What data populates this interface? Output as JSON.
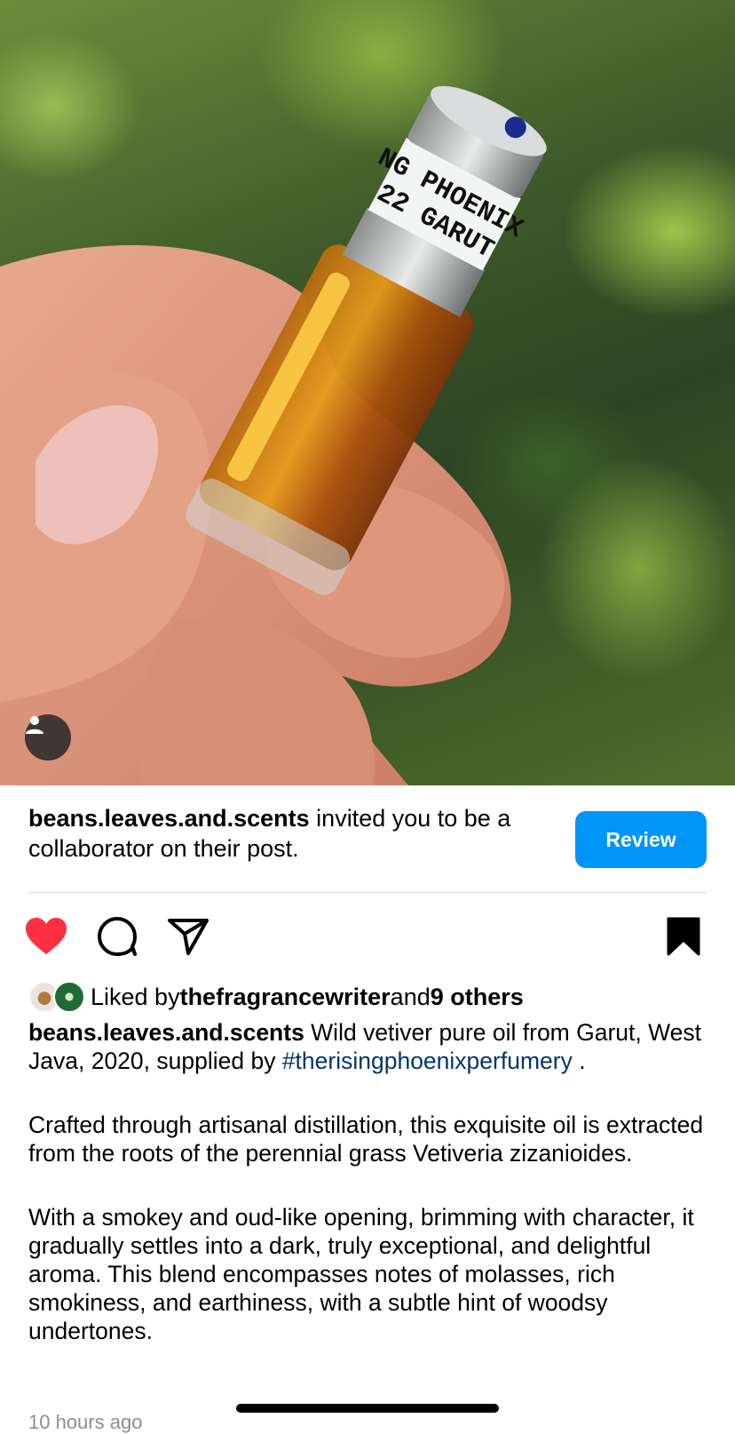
{
  "post": {
    "photo_label_line1": "NG PHOENIX",
    "photo_label_line2": "22 GARUT",
    "tag_icon": "person-icon"
  },
  "collab": {
    "username": "beans.leaves.and.scents",
    "message": " invited you to be a collaborator on their post.",
    "review_label": "Review",
    "review_color": "#0095f6"
  },
  "actions": {
    "like_icon": "heart-filled-icon",
    "like_color": "#ff3040",
    "comment_icon": "comment-icon",
    "share_icon": "send-icon",
    "save_icon": "bookmark-filled-icon"
  },
  "likes": {
    "prefix": "Liked by ",
    "user": "thefragrancewriter",
    "middle": " and ",
    "others": "9 others"
  },
  "caption": {
    "username": "beans.leaves.and.scents",
    "text1": " Wild vetiver pure oil from Garut, West Java, 2020, supplied by ",
    "hashtag": "#therisingphoenixperfumery",
    "text1_end": " .",
    "paragraph2": "Crafted through artisanal distillation, this exquisite oil is extracted from the roots of the perennial grass Vetiveria zizanioides.",
    "paragraph3": "With a smokey and oud-like opening, brimming with character, it gradually settles into a dark, truly exceptional, and delightful aroma. This blend encompasses notes of molasses, rich smokiness, and earthiness, with a subtle hint of woodsy undertones."
  },
  "timestamp": "10 hours ago"
}
